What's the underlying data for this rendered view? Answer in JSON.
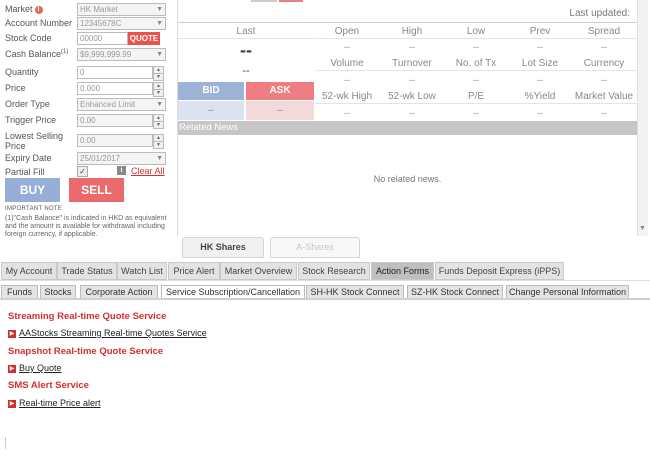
{
  "order_form": {
    "market": {
      "label": "Market",
      "value": "HK Market"
    },
    "account": {
      "label": "Account Number",
      "value": "12345678C"
    },
    "stock_code": {
      "label": "Stock Code",
      "value": "00000",
      "button": "QUOTE"
    },
    "cash_balance": {
      "label": "Cash Balance",
      "footnote": "(1)",
      "value": "$9,999,999.99"
    },
    "quantity": {
      "label": "Quantity",
      "value": "0"
    },
    "price": {
      "label": "Price",
      "value": "0.000"
    },
    "order_type": {
      "label": "Order Type",
      "value": "Enhanced Limit"
    },
    "trigger_price": {
      "label": "Trigger Price",
      "value": "0.00"
    },
    "lowest_selling_price": {
      "label": "Lowest Selling Price",
      "value": "0.00"
    },
    "expiry_date": {
      "label": "Expiry Date",
      "value": "25/01/2017"
    },
    "partial_fill": {
      "label": "Partial Fill",
      "clear_all": "Clear All"
    },
    "buy_label": "BUY",
    "sell_label": "SELL",
    "important_note_title": "IMPORTANT NOTE",
    "important_note_text": "(1)\"Cash Balance\" is indicated in HKD as equivalent and the amount is available for withdrawal including foreign currency, if applicable."
  },
  "market_panel": {
    "last_updated": "Last updated:",
    "last_header": "Last",
    "last_value": "--",
    "last_change": "--",
    "row1_headers": [
      "Open",
      "High",
      "Low",
      "Prev",
      "Spread"
    ],
    "row1_values": [
      "--",
      "--",
      "--",
      "--",
      "--"
    ],
    "row2_headers": [
      "Volume",
      "Turnover",
      "No. of Tx",
      "Lot Size",
      "Currency"
    ],
    "row2_values": [
      "--",
      "--",
      "--",
      "--",
      "--"
    ],
    "row3_headers": [
      "52-wk High",
      "52-wk Low",
      "P/E",
      "%Yield",
      "Market Value"
    ],
    "row3_values": [
      "--",
      "--",
      "--",
      "--",
      "--"
    ],
    "bid_label": "BID",
    "ask_label": "ASK",
    "bid_value": "--",
    "ask_value": "--",
    "related_news_title": "Related News",
    "no_news": "No related news."
  },
  "share_tabs": [
    "HK Shares",
    "A-Shares"
  ],
  "nav_tabs": [
    "My Account",
    "Trade Status",
    "Watch List",
    "Price Alert",
    "Market Overview",
    "Stock Research",
    "Action Forms",
    "Funds Deposit Express (iPPS)"
  ],
  "sub_tabs": [
    "Funds",
    "Stocks",
    "Corporate Action",
    "Service Subscription/Cancellation",
    "SH-HK Stock Connect",
    "SZ-HK Stock Connect",
    "Change Personal Information"
  ],
  "content": {
    "streaming_title": "Streaming Real-time Quote Service",
    "streaming_link": "AAStocks Streaming Real-time Quotes Service",
    "snapshot_title": "Snapshot Real-time Quote Service",
    "snapshot_link": "Buy Quote",
    "sms_title": "SMS Alert Service",
    "sms_link": "Real-time Price alert"
  },
  "colors": {
    "bid": "#9db3d6",
    "ask": "#ef7e82",
    "buy": "#97aed6",
    "sell": "#ea6a6e",
    "accent_red": "#d4302b"
  }
}
